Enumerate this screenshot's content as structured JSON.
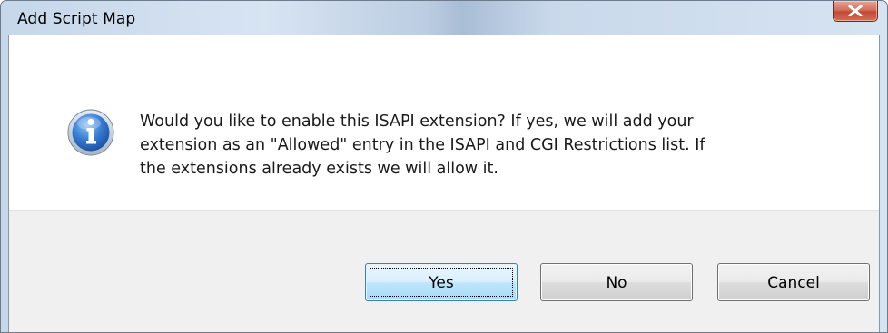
{
  "window": {
    "title": "Add Script Map",
    "close_icon": "close-x-icon"
  },
  "message": {
    "icon": "information-icon",
    "line1": "Would you like to enable this ISAPI extension? If yes, we will add your",
    "line2": "extension as an \"Allowed\" entry in the ISAPI and CGI Restrictions list. If",
    "line3": "the extensions already exists we will allow it."
  },
  "buttons": {
    "yes": {
      "mnemonic": "Y",
      "rest": "es"
    },
    "no": {
      "mnemonic": "N",
      "rest": "o"
    },
    "cancel": {
      "label": "Cancel"
    }
  },
  "colors": {
    "info_icon": "#2f6fc4",
    "close_button": "#c9503a",
    "default_button_border": "#3c7fb1"
  }
}
